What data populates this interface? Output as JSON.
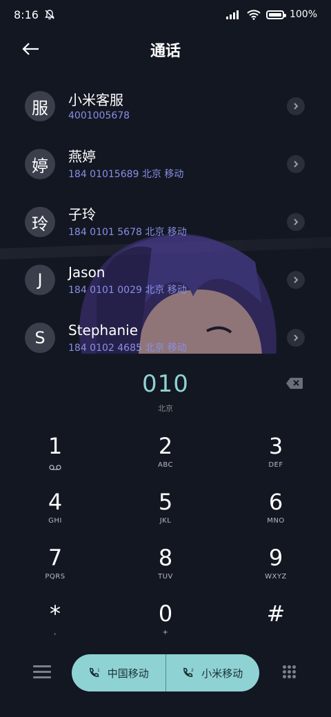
{
  "status": {
    "time": "8:16",
    "battery": "100%"
  },
  "header": {
    "title": "通话"
  },
  "contacts": [
    {
      "avatar": "服",
      "name": "小米客服",
      "detail": "4001005678"
    },
    {
      "avatar": "婷",
      "name": "燕婷",
      "detail": "184 01015689  北京 移动"
    },
    {
      "avatar": "玲",
      "name": "子玲",
      "detail": "184 0101 5678  北京 移动"
    },
    {
      "avatar": "J",
      "name": "Jason",
      "detail": "184 0101 0029  北京 移动"
    },
    {
      "avatar": "S",
      "name": "Stephanie",
      "detail": "184 0102 4685  北京 移动"
    }
  ],
  "dial": {
    "number": "010",
    "location": "北京"
  },
  "keys": [
    {
      "digit": "1",
      "letters": ""
    },
    {
      "digit": "2",
      "letters": "ABC"
    },
    {
      "digit": "3",
      "letters": "DEF"
    },
    {
      "digit": "4",
      "letters": "GHI"
    },
    {
      "digit": "5",
      "letters": "JKL"
    },
    {
      "digit": "6",
      "letters": "MNO"
    },
    {
      "digit": "7",
      "letters": "PQRS"
    },
    {
      "digit": "8",
      "letters": "TUV"
    },
    {
      "digit": "9",
      "letters": "WXYZ"
    },
    {
      "digit": "*",
      "letters": ","
    },
    {
      "digit": "0",
      "letters": "+"
    },
    {
      "digit": "#",
      "letters": ""
    }
  ],
  "call": {
    "sim1_label": "中国移动",
    "sim2_label": "小米移动",
    "sim1_index": "1",
    "sim2_index": "2"
  },
  "colors": {
    "accent": "#8fd2d4",
    "background": "#131722",
    "detail_text": "#8a8fe6"
  }
}
